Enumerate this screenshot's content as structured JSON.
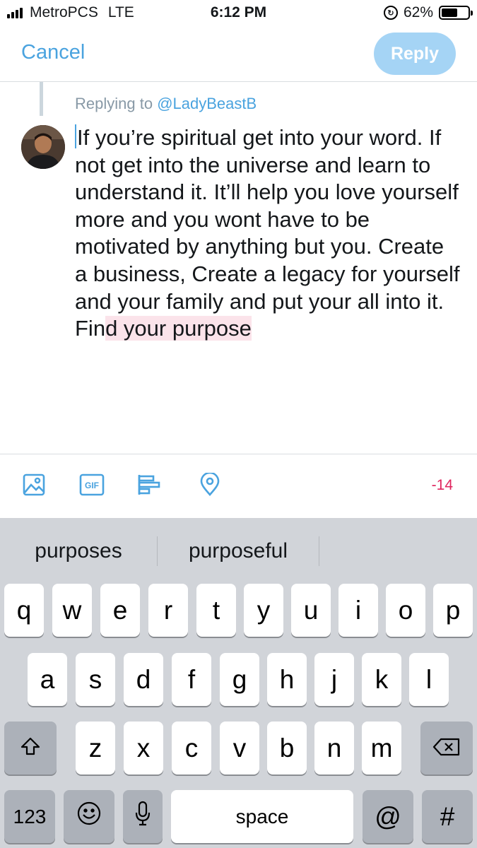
{
  "status_bar": {
    "carrier": "MetroPCS",
    "network": "LTE",
    "time": "6:12 PM",
    "battery": "62%",
    "battery_level": 0.62
  },
  "nav": {
    "cancel_label": "Cancel",
    "reply_label": "Reply"
  },
  "compose": {
    "replying_prefix": "Replying to",
    "replying_handle": "@LadyBeastB",
    "text_main": "If you’re spiritual get into your word. If not get into the universe and learn to understand it. It’ll help you love yourself more and you wont have to be motivated by anything but you. Create a business, Create a legacy for yourself and your family and put your all into it. Fin",
    "text_marked": "d your purpose"
  },
  "toolbar": {
    "icons": [
      "image-icon",
      "gif-icon",
      "poll-icon",
      "location-pin-icon"
    ],
    "gif_label": "GIF",
    "char_counter": "-14"
  },
  "keyboard": {
    "suggestions": [
      "purposes",
      "purposeful",
      ""
    ],
    "row1": [
      "q",
      "w",
      "e",
      "r",
      "t",
      "y",
      "u",
      "i",
      "o",
      "p"
    ],
    "row2": [
      "a",
      "s",
      "d",
      "f",
      "g",
      "h",
      "j",
      "k",
      "l"
    ],
    "row3": [
      "z",
      "x",
      "c",
      "v",
      "b",
      "n",
      "m"
    ],
    "numbers_label": "123",
    "space_label": "space",
    "at_label": "@",
    "hash_label": "#"
  },
  "colors": {
    "accent": "#4aa3df",
    "reply_button_disabled": "#a5d4f5",
    "counter_negative": "#e0245e",
    "text_highlight": "#fbe3ea",
    "keyboard_bg": "#d1d4d9"
  }
}
